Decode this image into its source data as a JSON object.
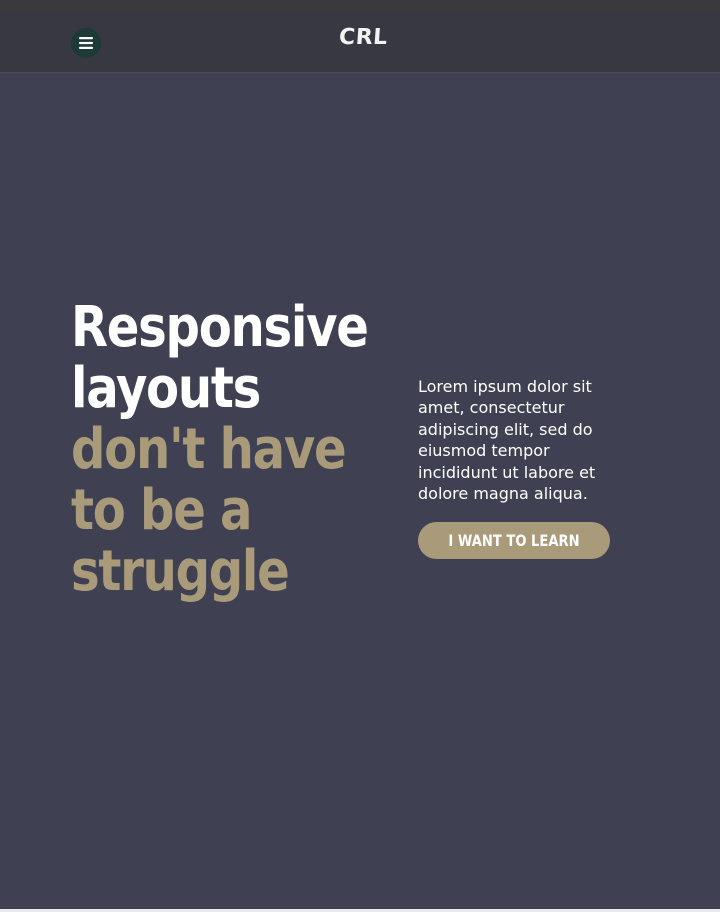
{
  "header": {
    "logo": "CRL",
    "menu_icon": "hamburger-menu-icon"
  },
  "hero": {
    "headline_white": [
      "Responsive",
      "layouts"
    ],
    "headline_accent": [
      "don't have",
      "to be a",
      "struggle"
    ],
    "body": "Lorem ipsum dolor sit amet, consectetur adipiscing elit, sed do eiusmod tempor incididunt ut labore et dolore magna aliqua.",
    "cta_label": "I WANT TO LEARN"
  },
  "colors": {
    "background": "#3f4152",
    "navbar": "#373842",
    "accent": "#a99a79",
    "menu_button": "#1d3a36",
    "text": "#ffffff"
  }
}
